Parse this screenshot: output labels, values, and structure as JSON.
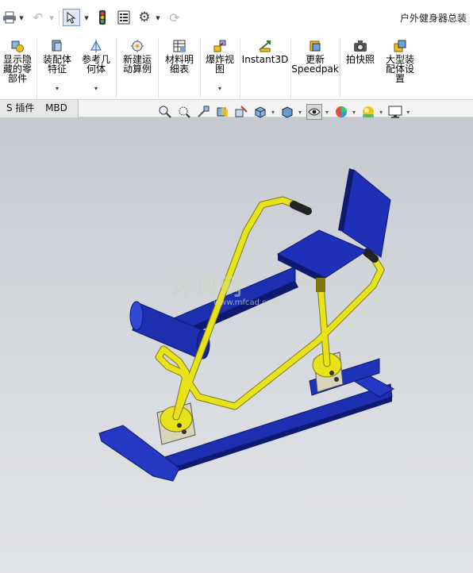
{
  "window": {
    "document_title": "户外健身器总装"
  },
  "quick_access": {
    "items": [
      {
        "icon": "printer-icon"
      },
      {
        "icon": "undo-icon"
      },
      {
        "icon": "select-arrow-icon"
      },
      {
        "icon": "traffic-light-icon"
      },
      {
        "icon": "file-properties-icon"
      },
      {
        "icon": "gear-icon"
      },
      {
        "icon": "rebuild-icon"
      }
    ]
  },
  "ribbon": {
    "buttons": [
      {
        "id": "show-hidden",
        "label": "显示隐\n藏的零\n部件",
        "icon": "show-components-icon"
      },
      {
        "id": "assembly-feature",
        "label": "装配体\n特征",
        "icon": "assembly-feature-icon"
      },
      {
        "id": "reference-geometry",
        "label": "参考几\n何体",
        "icon": "reference-geometry-icon"
      },
      {
        "id": "new-motion-study",
        "label": "新建运\n动算例",
        "icon": "motion-study-icon"
      },
      {
        "id": "bill-of-materials",
        "label": "材料明\n细表",
        "icon": "bom-table-icon"
      },
      {
        "id": "exploded-view",
        "label": "爆炸视\n图",
        "icon": "exploded-view-icon"
      },
      {
        "id": "instant3d",
        "label": "Instant3D",
        "icon": "instant3d-icon"
      },
      {
        "id": "update-speedpak",
        "label": "更新\nSpeedpak",
        "icon": "speedpak-icon"
      },
      {
        "id": "snapshot",
        "label": "拍快照",
        "icon": "camera-icon"
      },
      {
        "id": "large-assembly",
        "label": "大型装\n配体设\n置",
        "icon": "large-assembly-icon"
      }
    ]
  },
  "tabs": [
    {
      "label": "S 插件"
    },
    {
      "label": "MBD"
    }
  ],
  "heads_up_toolbar": {
    "icons": [
      "zoom-to-fit-icon",
      "zoom-to-area-icon",
      "previous-view-icon",
      "section-view-icon",
      "dynamic-annotation-icon",
      "view-orientation-icon",
      "display-style-icon",
      "hide-show-items-icon",
      "edit-appearance-icon",
      "apply-scene-icon",
      "view-settings-icon"
    ]
  },
  "model": {
    "name": "outdoor-fitness-rower",
    "colors": {
      "frame": "#e8e21a",
      "base": "#1b2fb0",
      "seat": "#1e2fb8",
      "grip": "#222222"
    }
  },
  "watermark": {
    "main": "沐风网",
    "sub": "www.mfcad.com"
  }
}
